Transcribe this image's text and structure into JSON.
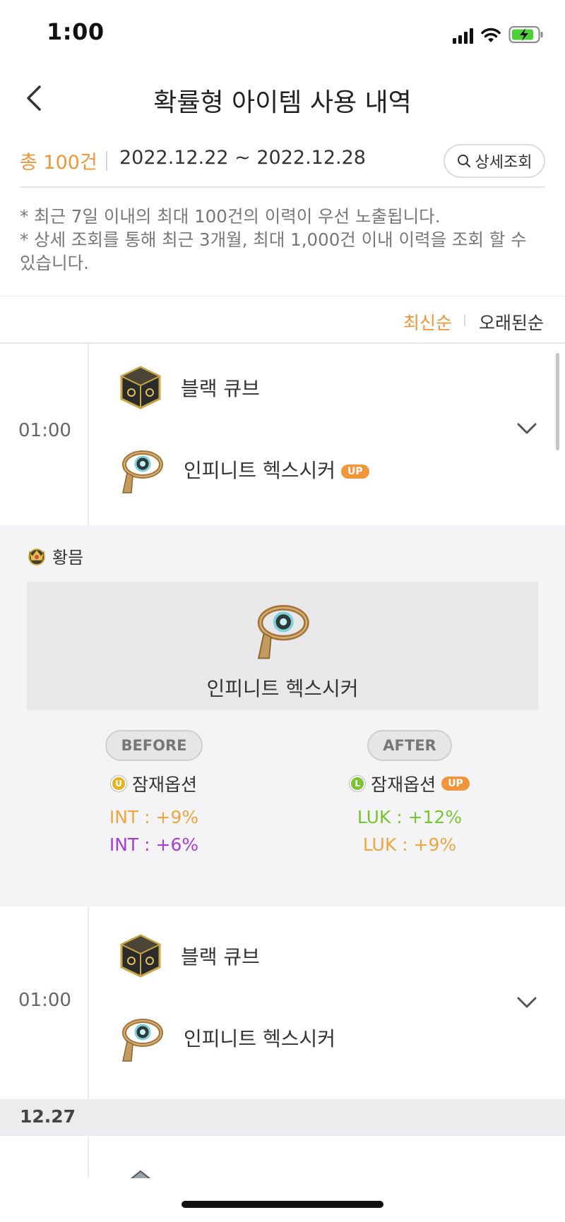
{
  "status_bar": {
    "time": "1:00",
    "icons": [
      "signal-icon",
      "wifi-icon",
      "battery-charging-icon"
    ],
    "battery_color": "#4cd137"
  },
  "header": {
    "title": "확률형 아이템 사용 내역",
    "back_icon": "chevron-left-icon"
  },
  "summary": {
    "total": "총 100건",
    "date_range": "2022.12.22 ~ 2022.12.28",
    "detail_button": "상세조회",
    "accent_color": "#f0953a"
  },
  "notice": {
    "line1": "* 최근 7일 이내의 최대 100건의 이력이 우선 노출됩니다.",
    "line2": "* 상세 조회를 통해 최근 3개월, 최대 1,000건 이내 이력을 조회 할 수 있습니다."
  },
  "sort": {
    "newest": "최신순",
    "oldest": "오래된순",
    "selected": "최신순"
  },
  "entries": [
    {
      "time": "01:00",
      "used_item": "블랙 큐브",
      "target_item": "인피니트 헥스시커",
      "up_badge": "UP",
      "expanded": true
    },
    {
      "time": "01:00",
      "used_item": "블랙 큐브",
      "target_item": "인피니트 헥스시커",
      "expanded": false
    }
  ],
  "detail": {
    "grade_label": "황믐",
    "item_name": "인피니트 헥스시커",
    "before": {
      "label": "BEFORE",
      "potential_label": "잠재옵션",
      "grade_letter": "U",
      "grade_color": "#e8b21f",
      "options": [
        "INT : +9%",
        "INT : +6%"
      ],
      "option_colors": [
        "#f0a640",
        "#a43ed9"
      ]
    },
    "after": {
      "label": "AFTER",
      "potential_label": "잠재옵션",
      "up_badge": "UP",
      "grade_letter": "L",
      "grade_color": "#7ac431",
      "options": [
        "LUK : +12%",
        "LUK : +9%"
      ],
      "option_colors": [
        "#7ac431",
        "#f0a640"
      ]
    }
  },
  "section_date": "12.27"
}
